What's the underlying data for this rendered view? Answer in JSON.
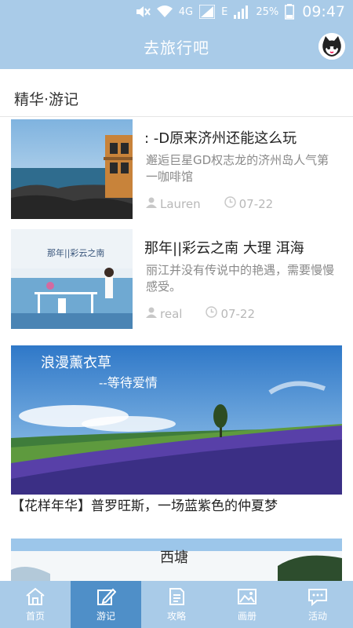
{
  "status_bar": {
    "network_label": "4G",
    "data_label": "E",
    "battery": "25%",
    "time": "09:47"
  },
  "app_bar": {
    "title": "去旅行吧",
    "avatar_icon": "cat-avatar-icon"
  },
  "section": {
    "title": "精华·游记"
  },
  "articles": [
    {
      "title": ": -D原来济州还能这么玩",
      "summary": "邂逅巨星GD权志龙的济州岛人气第一咖啡馆",
      "author": "Lauren",
      "date": "07-22"
    },
    {
      "title": "那年||彩云之南  大理  洱海",
      "summary": "丽江并没有传说中的艳遇，需要慢慢感受。",
      "author": "real",
      "date": "07-22",
      "thumb_text": "那年||彩云之南"
    }
  ],
  "features": [
    {
      "title": "【花样年华】普罗旺斯，一场蓝紫色的仲夏梦",
      "overlay_line1": "浪漫薰衣草",
      "overlay_line2": "--等待爱情"
    },
    {
      "overlay_line1": "西塘"
    }
  ],
  "bottom_nav": [
    {
      "label": "首页",
      "icon": "home-icon"
    },
    {
      "label": "游记",
      "icon": "edit-icon",
      "active": true
    },
    {
      "label": "攻略",
      "icon": "document-icon"
    },
    {
      "label": "画册",
      "icon": "picture-icon"
    },
    {
      "label": "活动",
      "icon": "chat-icon"
    }
  ],
  "colors": {
    "primary": "#a9cbe8",
    "active_tab": "#4f8fc8"
  }
}
